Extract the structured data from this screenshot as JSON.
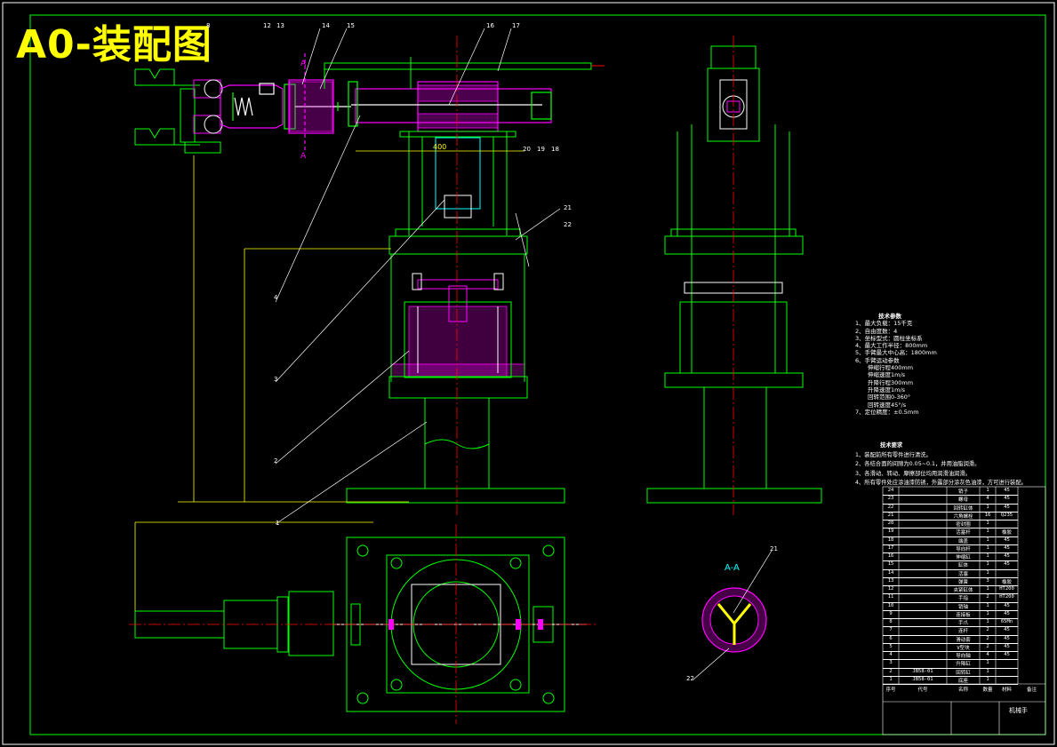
{
  "title": "A0-装配图",
  "section_label": "A-A",
  "section_marks": [
    "A",
    "A"
  ],
  "dimension_label": "400",
  "balloons": [
    "1",
    "2",
    "3",
    "4",
    "8",
    "12",
    "13",
    "14",
    "15",
    "16",
    "17",
    "18",
    "19",
    "20",
    "21",
    "22"
  ],
  "spec_title": "技术参数",
  "spec_lines": [
    "1、最大负载：15千克",
    "2、自由度数：4",
    "3、坐标型式：圆柱坐标系",
    "4、最大工作半径：800mm",
    "5、手臂最大中心高：1800mm",
    "6、手臂运动参数",
    "伸缩行程400mm",
    "伸缩速度1m/s",
    "升降行程300mm",
    "升降速度1m/s",
    "回转范围0-360°",
    "回转速度45°/s",
    "7、定位精度：±0.5mm"
  ],
  "req_title": "技术要求",
  "req_lines": [
    "1、装配前所有零件进行清洗。",
    "2、各结合面的间隙为0.05~0.1，并用油脂润滑。",
    "3、各滑动、转动、摩擦部位均用润滑油润滑。",
    "4、所有零件处应涂油漆防锈，外露部分涂灰色油漆，方可进行装配。"
  ],
  "bom_rows": [
    [
      "24",
      "",
      "销子",
      "1",
      "45"
    ],
    [
      "23",
      "",
      "螺母",
      "4",
      "45"
    ],
    [
      "22",
      "",
      "回转缸体",
      "1",
      "45"
    ],
    [
      "21",
      "",
      "六角螺栓",
      "16",
      "Q235"
    ],
    [
      "20",
      "",
      "密封圈",
      "1",
      ""
    ],
    [
      "19",
      "",
      "活塞杆",
      "1",
      "橡胶"
    ],
    [
      "18",
      "",
      "端盖",
      "1",
      "45"
    ],
    [
      "17",
      "",
      "导向杆",
      "1",
      "45"
    ],
    [
      "16",
      "",
      "伸缩缸",
      "1",
      "45"
    ],
    [
      "15",
      "",
      "缸体",
      "1",
      "45"
    ],
    [
      "14",
      "",
      "活塞",
      "1",
      ""
    ],
    [
      "13",
      "",
      "弹簧",
      "3",
      "橡胶"
    ],
    [
      "12",
      "",
      "夹紧缸体",
      "1",
      "HT200"
    ],
    [
      "11",
      "",
      "手指",
      "2",
      "HT200"
    ],
    [
      "10",
      "",
      "销轴",
      "1",
      "45"
    ],
    [
      "9",
      "",
      "连接板",
      "1",
      "45"
    ],
    [
      "8",
      "",
      "手爪",
      "1",
      "65Mn"
    ],
    [
      "7",
      "",
      "连杆",
      "2",
      "45"
    ],
    [
      "6",
      "",
      "滑动套",
      "2",
      "45"
    ],
    [
      "5",
      "",
      "V型块",
      "2",
      "45"
    ],
    [
      "4",
      "",
      "导向轴",
      "4",
      "45"
    ],
    [
      "3",
      "",
      "升降缸",
      "1",
      ""
    ],
    [
      "2",
      "JB58-01",
      "回转缸",
      "1",
      ""
    ],
    [
      "1",
      "JB58-01",
      "底座",
      "1",
      ""
    ]
  ],
  "bom_header": [
    "序号",
    "代号",
    "名称",
    "数量",
    "材料",
    "备注"
  ],
  "title_block_name": "机械手",
  "colors": {
    "bg": "#000000",
    "outline": "#00ff00",
    "dimension": "#ffff00",
    "section": "#ff00ff",
    "centerline": "#ff0000",
    "annotation": "#00ffff",
    "part_white": "#ffffff"
  }
}
